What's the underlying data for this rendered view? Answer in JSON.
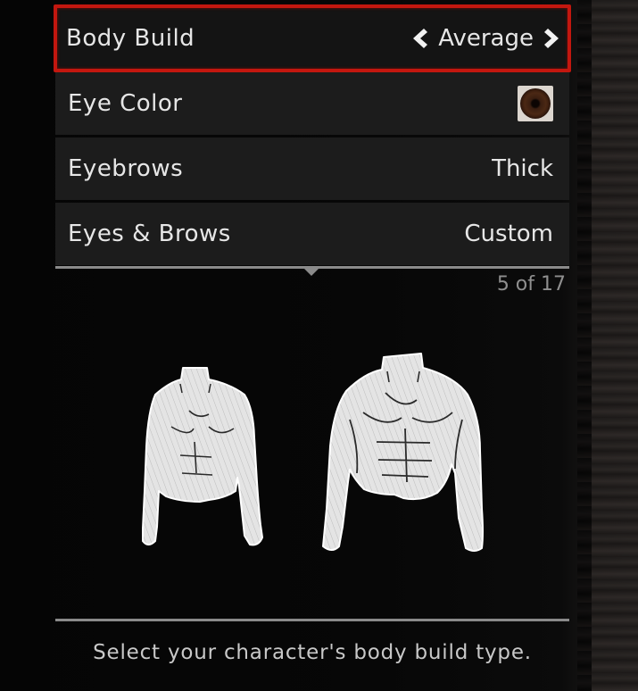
{
  "menu": {
    "items": [
      {
        "label": "Body Build",
        "value": "Average",
        "selected": true
      },
      {
        "label": "Eye Color",
        "swatch_color": "#4b2814"
      },
      {
        "label": "Eyebrows",
        "value": "Thick"
      },
      {
        "label": "Eyes & Brows",
        "value": "Custom"
      }
    ]
  },
  "preview": {
    "counter": "5 of 17",
    "left_figure": "slim-torso",
    "right_figure": "muscular-torso"
  },
  "description": "Select your character's body build type.",
  "colors": {
    "selection_border": "#c3170f",
    "row_background": "#1c1c1c",
    "text": "#e6e6e6",
    "divider": "#8a8a8a"
  }
}
